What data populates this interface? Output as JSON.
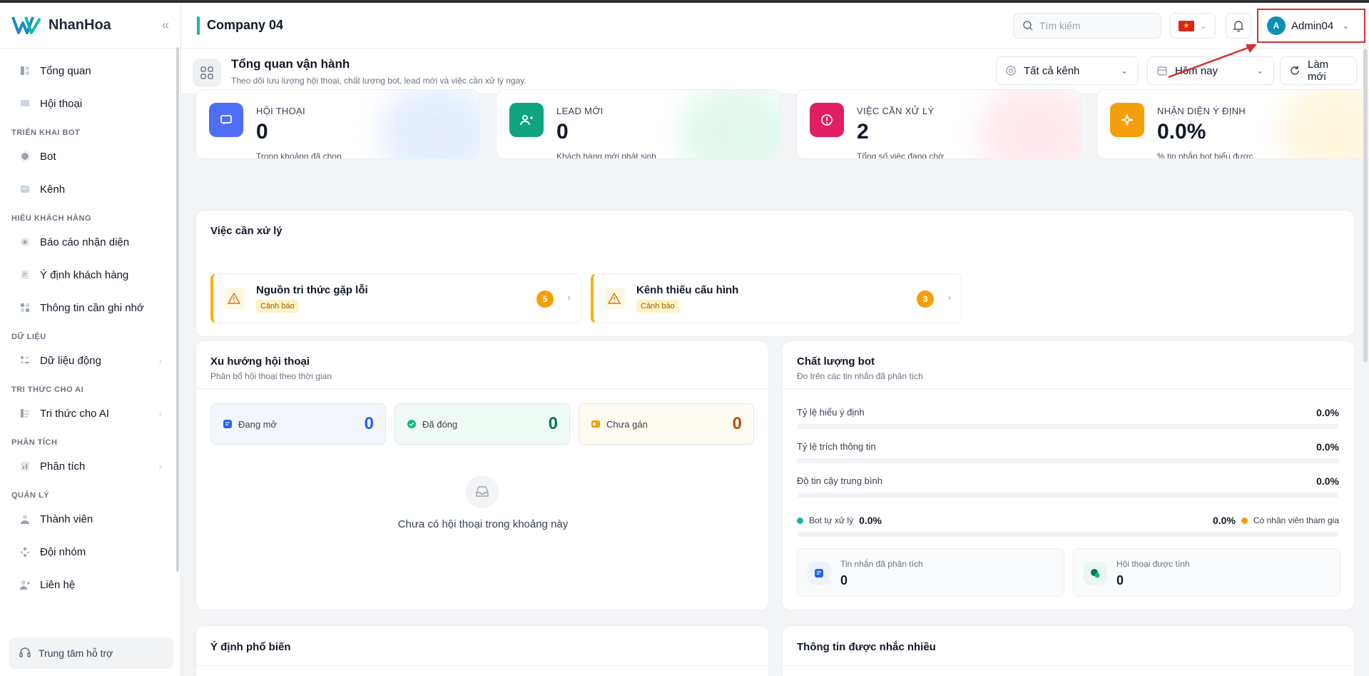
{
  "brand": {
    "name": "NhanHoa"
  },
  "sidebar": {
    "sections": [
      {
        "title": "",
        "items": [
          {
            "label": "Tổng quan",
            "icon": "dashboard-icon"
          },
          {
            "label": "Hội thoại",
            "icon": "chat-icon"
          }
        ]
      },
      {
        "title": "TRIỂN KHAI BOT",
        "items": [
          {
            "label": "Bot",
            "icon": "bot-icon"
          },
          {
            "label": "Kênh",
            "icon": "channel-icon"
          }
        ]
      },
      {
        "title": "HIỂU KHÁCH HÀNG",
        "items": [
          {
            "label": "Báo cáo nhận diện",
            "icon": "report-icon"
          },
          {
            "label": "Ý định khách hàng",
            "icon": "intent-icon"
          },
          {
            "label": "Thông tin cần ghi nhớ",
            "icon": "memory-icon"
          }
        ]
      },
      {
        "title": "DỮ LIỆU",
        "items": [
          {
            "label": "Dữ liệu động",
            "icon": "data-icon",
            "expandable": true
          }
        ]
      },
      {
        "title": "TRI THỨC CHO AI",
        "items": [
          {
            "label": "Tri thức cho AI",
            "icon": "knowledge-icon",
            "expandable": true
          }
        ]
      },
      {
        "title": "PHÂN TÍCH",
        "items": [
          {
            "label": "Phân tích",
            "icon": "analytics-icon",
            "expandable": true
          }
        ]
      },
      {
        "title": "QUẢN LÝ",
        "items": [
          {
            "label": "Thành viên",
            "icon": "member-icon"
          },
          {
            "label": "Đội nhóm",
            "icon": "team-icon"
          },
          {
            "label": "Liên hệ",
            "icon": "contact-icon"
          }
        ]
      }
    ],
    "support_label": "Trung tâm hỗ trợ"
  },
  "header": {
    "company": "Company 04",
    "search_placeholder": "Tìm kiếm",
    "user_initial": "A",
    "user_name": "Admin04"
  },
  "page": {
    "title": "Tổng quan vận hành",
    "subtitle": "Theo dõi lưu lượng hội thoại, chất lượng bot, lead mới và việc cần xử lý ngay.",
    "channel_filter": "Tất cả kênh",
    "date_filter": "Hôm nay",
    "refresh_label": "Làm mới"
  },
  "stats": [
    {
      "label": "HỘI THOẠI",
      "value": "0",
      "sub": "Trong khoảng đã chọn",
      "color": "#4f6ef7",
      "glow": "#cfe0ff"
    },
    {
      "label": "LEAD MỚI",
      "value": "0",
      "sub": "Khách hàng mới phát sinh",
      "color": "#10a37f",
      "glow": "#c9f2dd"
    },
    {
      "label": "VIỆC CẦN XỬ LÝ",
      "value": "2",
      "sub": "Tổng số việc đang chờ",
      "color": "#e11d63",
      "glow": "#ffd6df"
    },
    {
      "label": "NHẬN DIỆN Ý ĐỊNH",
      "value": "0.0%",
      "sub": "% tin nhắn bot hiểu được",
      "color": "#f59e0b",
      "glow": "#ffefc2"
    }
  ],
  "tasks": {
    "title": "Việc cần xử lý",
    "items": [
      {
        "name": "Nguồn tri thức gặp lỗi",
        "badge": "Cảnh báo",
        "count": "5"
      },
      {
        "name": "Kênh thiếu cấu hình",
        "badge": "Cảnh báo",
        "count": "3"
      }
    ]
  },
  "trend": {
    "title": "Xu hướng hội thoại",
    "subtitle": "Phân bổ hội thoại theo thời gian",
    "pills": [
      {
        "label": "Đang mở",
        "value": "0",
        "color": "#2563eb",
        "bg": "#f3f6fc"
      },
      {
        "label": "Đã đóng",
        "value": "0",
        "color": "#047857",
        "bg": "#f1fbf6"
      },
      {
        "label": "Chưa gán",
        "value": "0",
        "color": "#b45309",
        "bg": "#fffbf0"
      }
    ],
    "empty_text": "Chưa có hội thoại trong khoảng này"
  },
  "quality": {
    "title": "Chất lượng bot",
    "subtitle": "Đo trên các tin nhắn đã phân tích",
    "rows": [
      {
        "label": "Tỷ lệ hiểu ý định",
        "value": "0.0%",
        "fill": 0
      },
      {
        "label": "Tỷ lệ trích thông tin",
        "value": "0.0%",
        "fill": 0
      },
      {
        "label": "Độ tin cậy trung bình",
        "value": "0.0%",
        "fill": 0
      }
    ],
    "split": {
      "left_label": "Bot tự xử lý",
      "left_value": "0.0%",
      "right_value": "0.0%",
      "right_label": "Có nhân viên tham gia",
      "left_color": "#14b8a6",
      "right_color": "#f59e0b"
    },
    "minis": [
      {
        "label": "Tin nhắn đã phân tích",
        "value": "0"
      },
      {
        "label": "Hội thoại được tính",
        "value": "0"
      }
    ]
  },
  "bottom": {
    "left_title": "Ý định phổ biến",
    "right_title": "Thông tin được nhắc nhiều"
  }
}
